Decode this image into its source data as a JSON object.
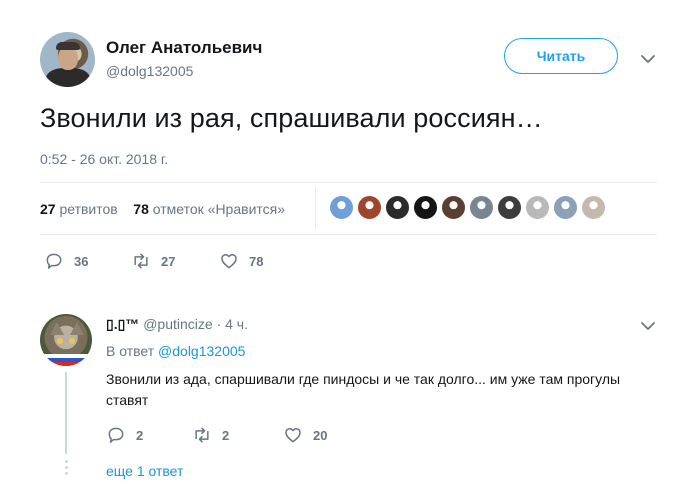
{
  "tweet": {
    "author_name": "Олег Анатольевич",
    "author_handle": "@dolg132005",
    "follow_label": "Читать",
    "text": "Звонили из рая, спрашивали россиян…",
    "timestamp": "0:52 - 26 окт. 2018 г.",
    "stats": {
      "retweets_count": "27",
      "retweets_label": "ретвитов",
      "likes_count": "78",
      "likes_label": "отметок «Нравится»"
    },
    "likers": [
      "#6f9fd8",
      "#a0442c",
      "#2b2b2b",
      "#151515",
      "#5a4032",
      "#7a8592",
      "#3d3d3d",
      "#b9b9b9",
      "#8aa1b8",
      "#c4b9ae"
    ],
    "actions": {
      "replies": "36",
      "retweets": "27",
      "likes": "78"
    }
  },
  "reply": {
    "name": "▯.▯™",
    "handle": "@putincize",
    "time": "· 4 ч.",
    "in_reply_label": "В ответ",
    "in_reply_handle": "@dolg132005",
    "text": "Звонили из ада, спаршивали где пиндосы и че так долго... им уже там прогулы ставят",
    "actions": {
      "replies": "2",
      "retweets": "2",
      "likes": "20"
    },
    "more_replies": "еще 1 ответ"
  },
  "colors": {
    "accent": "#1da1f2",
    "muted": "#657786",
    "divider": "#e6ecf0"
  },
  "icons": [
    "chevron-down-icon",
    "reply-icon",
    "retweet-icon",
    "heart-icon"
  ]
}
